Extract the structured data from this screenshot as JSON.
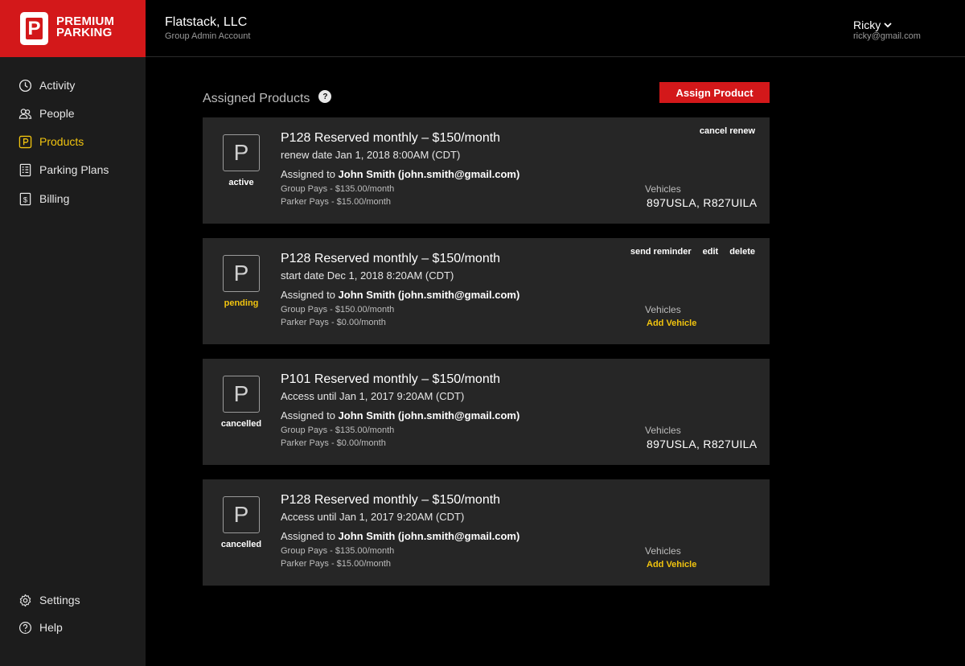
{
  "brand": {
    "line1": "PREMIUM",
    "line2": "PARKING",
    "mark": "P",
    "color": "#d3181a"
  },
  "header": {
    "org_name": "Flatstack, LLC",
    "org_sub": "Group Admin Account",
    "user_name": "Ricky",
    "user_email": "ricky@gmail.com"
  },
  "sidebar": {
    "items": [
      {
        "label": "Activity",
        "icon": "clock-icon"
      },
      {
        "label": "People",
        "icon": "people-icon"
      },
      {
        "label": "Products",
        "icon": "parking-icon",
        "active": true
      },
      {
        "label": "Parking Plans",
        "icon": "plans-icon"
      },
      {
        "label": "Billing",
        "icon": "billing-icon"
      }
    ],
    "bottom": [
      {
        "label": "Settings",
        "icon": "gear-icon"
      },
      {
        "label": "Help",
        "icon": "help-icon"
      }
    ]
  },
  "main": {
    "title": "Assigned Products",
    "help": "?",
    "assign_label": "Assign Product",
    "cards": [
      {
        "icon": "P",
        "status": "active",
        "title": "P128 Reserved monthly – $150/month",
        "date": "renew date Jan 1, 2018 8:00AM (CDT)",
        "assigned_prefix": "Assigned to ",
        "assignee": "John Smith (john.smith@gmail.com)",
        "group_pays": "Group Pays  - $135.00/month",
        "parker_pays": "Parker Pays - $15.00/month",
        "actions": [
          "cancel renew"
        ],
        "vehicles_label": "Vehicles",
        "vehicles": "897USLA, R827UILA"
      },
      {
        "icon": "P",
        "status": "pending",
        "title": "P128 Reserved monthly – $150/month",
        "date": "start date Dec 1, 2018 8:20AM (CDT)",
        "assigned_prefix": "Assigned to ",
        "assignee": "John Smith (john.smith@gmail.com)",
        "group_pays": "Group Pays  - $150.00/month",
        "parker_pays": "Parker Pays - $0.00/month",
        "actions": [
          "send reminder",
          "edit",
          "delete"
        ],
        "vehicles_label": "Vehicles",
        "add_vehicle": "Add Vehicle"
      },
      {
        "icon": "P",
        "status": "cancelled",
        "title": "P101 Reserved monthly – $150/month",
        "date": "Access until Jan 1, 2017 9:20AM (CDT)",
        "assigned_prefix": "Assigned to ",
        "assignee": "John Smith (john.smith@gmail.com)",
        "group_pays": "Group Pays  - $135.00/month",
        "parker_pays": "Parker Pays - $0.00/month",
        "vehicles_label": "Vehicles",
        "vehicles": "897USLA, R827UILA"
      },
      {
        "icon": "P",
        "status": "cancelled",
        "title": "P128 Reserved monthly – $150/month",
        "date": "Access until Jan 1, 2017 9:20AM (CDT)",
        "assigned_prefix": "Assigned to ",
        "assignee": "John Smith (john.smith@gmail.com)",
        "group_pays": "Group Pays  - $135.00/month",
        "parker_pays": "Parker Pays - $15.00/month",
        "vehicles_label": "Vehicles",
        "add_vehicle": "Add Vehicle"
      }
    ]
  }
}
